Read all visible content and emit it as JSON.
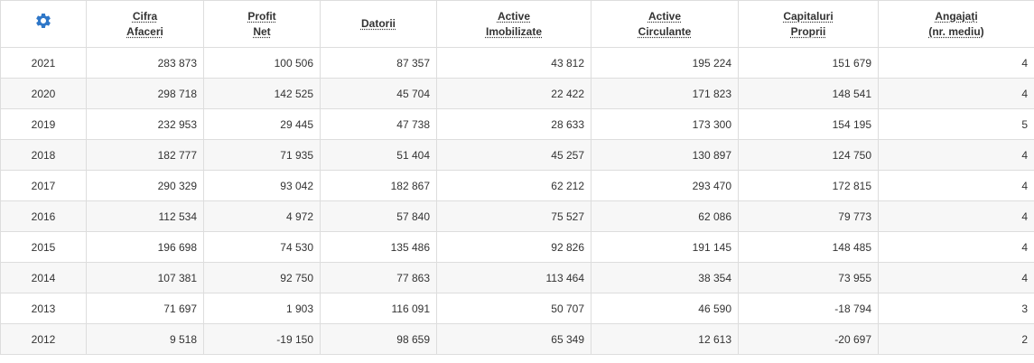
{
  "theme": {
    "accent": "#2f77c8",
    "border": "#dddddd",
    "stripe": "#f7f7f7"
  },
  "settings": {
    "icon": "gear-icon"
  },
  "columns": [
    {
      "line1": "Cifra",
      "line2": "Afaceri"
    },
    {
      "line1": "Profit",
      "line2": "Net"
    },
    {
      "line1": "Datorii",
      "line2": ""
    },
    {
      "line1": "Active",
      "line2": "Imobilizate"
    },
    {
      "line1": "Active",
      "line2": "Circulante"
    },
    {
      "line1": "Capitaluri",
      "line2": "Proprii"
    },
    {
      "line1": "Angajați",
      "line2": "(nr. mediu)"
    }
  ],
  "rows": [
    {
      "year": "2021",
      "values": [
        "283 873",
        "100 506",
        "87 357",
        "43 812",
        "195 224",
        "151 679",
        "4"
      ]
    },
    {
      "year": "2020",
      "values": [
        "298 718",
        "142 525",
        "45 704",
        "22 422",
        "171 823",
        "148 541",
        "4"
      ]
    },
    {
      "year": "2019",
      "values": [
        "232 953",
        "29 445",
        "47 738",
        "28 633",
        "173 300",
        "154 195",
        "5"
      ]
    },
    {
      "year": "2018",
      "values": [
        "182 777",
        "71 935",
        "51 404",
        "45 257",
        "130 897",
        "124 750",
        "4"
      ]
    },
    {
      "year": "2017",
      "values": [
        "290 329",
        "93 042",
        "182 867",
        "62 212",
        "293 470",
        "172 815",
        "4"
      ]
    },
    {
      "year": "2016",
      "values": [
        "112 534",
        "4 972",
        "57 840",
        "75 527",
        "62 086",
        "79 773",
        "4"
      ]
    },
    {
      "year": "2015",
      "values": [
        "196 698",
        "74 530",
        "135 486",
        "92 826",
        "191 145",
        "148 485",
        "4"
      ]
    },
    {
      "year": "2014",
      "values": [
        "107 381",
        "92 750",
        "77 863",
        "113 464",
        "38 354",
        "73 955",
        "4"
      ]
    },
    {
      "year": "2013",
      "values": [
        "71 697",
        "1 903",
        "116 091",
        "50 707",
        "46 590",
        "-18 794",
        "3"
      ]
    },
    {
      "year": "2012",
      "values": [
        "9 518",
        "-19 150",
        "98 659",
        "65 349",
        "12 613",
        "-20 697",
        "2"
      ]
    }
  ]
}
